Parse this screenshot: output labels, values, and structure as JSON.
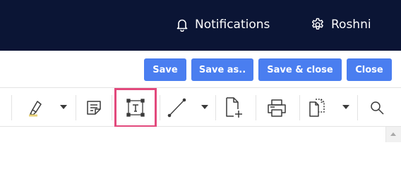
{
  "topbar": {
    "notifications": {
      "label": "Notifications",
      "icon": "bell-icon"
    },
    "user": {
      "name": "Roshni",
      "icon": "gear-icon"
    }
  },
  "actions": {
    "save": "Save",
    "save_as": "Save as..",
    "save_close": "Save & close",
    "close": "Close"
  },
  "toolbar": {
    "tools": [
      {
        "name": "highlighter",
        "icon": "highlighter-icon",
        "has_dropdown": true
      },
      {
        "name": "note",
        "icon": "note-icon",
        "has_dropdown": false
      },
      {
        "name": "text-box",
        "icon": "text-box-icon",
        "has_dropdown": false,
        "selected": true
      },
      {
        "name": "line",
        "icon": "line-icon",
        "has_dropdown": true
      },
      {
        "name": "add-page",
        "icon": "add-page-icon",
        "has_dropdown": false
      },
      {
        "name": "print",
        "icon": "print-icon",
        "has_dropdown": false
      },
      {
        "name": "copy",
        "icon": "copy-icon",
        "has_dropdown": true
      },
      {
        "name": "search",
        "icon": "search-icon",
        "has_dropdown": false
      }
    ]
  },
  "colors": {
    "topbar_bg": "#0b1535",
    "button_bg": "#4a7ef0",
    "selected_outline": "#e2497c",
    "icon": "#3a3a3a"
  }
}
